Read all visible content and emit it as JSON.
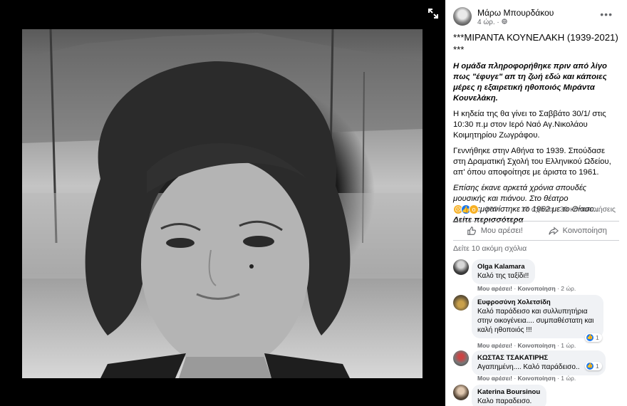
{
  "post": {
    "author": "Μάρω Μπουρδάκου",
    "time": "4 ώρ.",
    "more_label": "•••",
    "title": "***ΜΙΡΑΝΤΑ ΚΟΥΝΕΛΑΚΗ (1939-2021) ***",
    "p1": "Η ομάδα πληροφορήθηκε πριν από λίγο πως \"έφυγε\" απ τη ζωή εδώ και κάποιες μέρες η εξαιρετική ηθοποιός Μιράντα Κουνελάκη.",
    "p2": "Η κηδεία της θα γίνει το Σαββάτο 30/1/ στις 10:30 π.μ στον Ιερό Ναό Αγ.Νικολάου Κοιμητηρίου Ζωγράφου.",
    "p3": "Γεννήθηκε στην Αθήνα το 1939. Σπούδασε στη Δραματική Σχολή του Ελληνικού Ωδείου, απ' όπου αποφοίτησε με άριστα το 1961.",
    "p4": "Επίσης έκανε αρκετά χρόνια σπουδές μουσικής και πιάνου. Στο θέατρο πρωτοεμφανίστηκε το 1962 με το Θίασο...",
    "see_more": "Δείτε περισσότερα"
  },
  "stats": {
    "reactions": "233",
    "comments": "17 σχόλια",
    "shares": "30 κοινοποιήσεις"
  },
  "actions": {
    "like": "Μου αρέσει!",
    "share": "Κοινοποίηση"
  },
  "view_more_comments": "Δείτε 10 ακόμη σχόλια",
  "comments": [
    {
      "name": "Olga Kalamara",
      "text": "Καλό της ταξίδι!!",
      "like": "Μου αρέσει!",
      "reply": "Κοινοποίηση",
      "time": "2 ώρ.",
      "reactions": ""
    },
    {
      "name": "Ευφροσύνη Χολετσίδη",
      "text": "Καλό παράδεισο και συλλυπητήρια στην οικογένεια.... συμπαθέστατη και καλή ηθοποιός !!!",
      "like": "Μου αρέσει!",
      "reply": "Κοινοποίηση",
      "time": "1 ώρ.",
      "reactions": "1"
    },
    {
      "name": "ΚΩΣΤΑΣ ΤΣΑΚΑΤΙΡΗΣ",
      "text": "Αγαπημένη.... Καλό παράδεισο..",
      "like": "Μου αρέσει!",
      "reply": "Κοινοποίηση",
      "time": "1 ώρ.",
      "reactions": "1"
    },
    {
      "name": "Katerina Boursinou",
      "text": "Καλο παραδεισο.",
      "like": "",
      "reply": "",
      "time": "",
      "reactions": ""
    }
  ],
  "colors": {
    "link_blue": "#1877f2",
    "muted": "#65676b",
    "bubble": "#f0f2f5"
  }
}
